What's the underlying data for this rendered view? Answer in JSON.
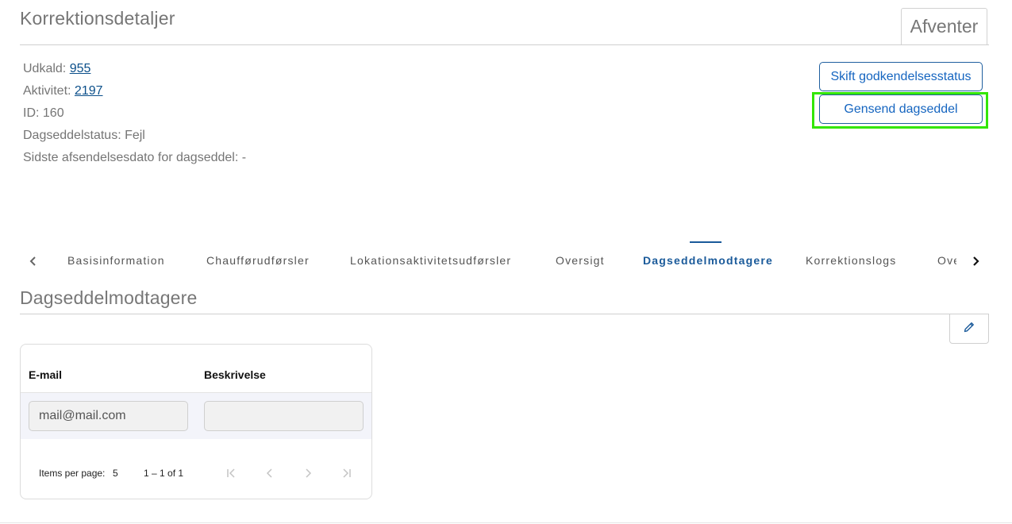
{
  "header": {
    "title": "Korrektionsdetaljer",
    "status": "Afventer"
  },
  "details": {
    "callout_label": "Udkald:",
    "callout_value": "955",
    "activity_label": "Aktivitet:",
    "activity_value": "2197",
    "id_text": "ID: 160",
    "status_text": "Dagseddelstatus: Fejl",
    "last_sent_text": "Sidste afsendelsesdato for dagseddel: -"
  },
  "actions": {
    "change_status": "Skift godkendelsesstatus",
    "resend": "Gensend dagseddel"
  },
  "tabs": [
    {
      "label": "Basisinformation"
    },
    {
      "label": "Chaufførudførsler"
    },
    {
      "label": "Lokationsaktivitetsudførsler"
    },
    {
      "label": "Oversigt"
    },
    {
      "label": "Dagseddelmodtagere"
    },
    {
      "label": "Korrektionslogs"
    },
    {
      "label": "Over"
    }
  ],
  "active_tab": "Dagseddelmodtagere",
  "section": {
    "title": "Dagseddelmodtagere"
  },
  "table": {
    "columns": [
      "E-mail",
      "Beskrivelse"
    ],
    "rows": [
      {
        "email": "mail@mail.com",
        "description": ""
      }
    ],
    "paginator": {
      "items_per_page_label": "Items per page:",
      "items_per_page_value": "5",
      "range": "1 – 1 of 1"
    }
  },
  "colors": {
    "accent": "#1a5a9a",
    "highlight": "#33e600"
  },
  "icons": [
    "chevron-left-icon",
    "chevron-right-icon",
    "pencil-icon",
    "first-page-icon",
    "previous-page-icon",
    "next-page-icon",
    "last-page-icon"
  ]
}
